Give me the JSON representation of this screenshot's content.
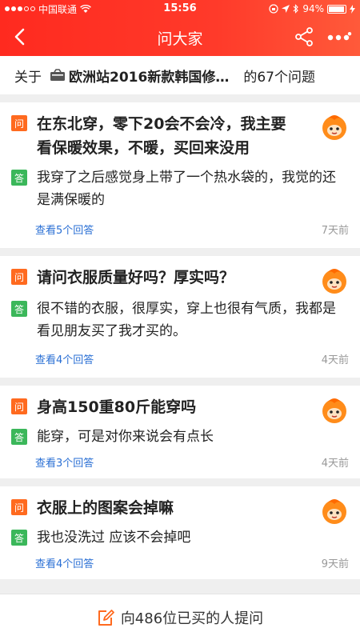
{
  "status_bar": {
    "carrier": "中国联通",
    "time": "15:56",
    "battery": "94%",
    "battery_level": 0.94
  },
  "nav": {
    "title": "问大家"
  },
  "about": {
    "prefix": "关于",
    "product": "欧洲站2016新款韩国修…",
    "suffix": "的67个问题"
  },
  "questions": [
    {
      "q_tag": "问",
      "question": "在东北穿，零下20会不会冷，我主要看保暖效果，不暖，买回来没用",
      "a_tag": "答",
      "answer": "我穿了之后感觉身上带了一个热水袋的，我觉的还是满保暖的",
      "link": "查看5个回答",
      "time": "7天前"
    },
    {
      "q_tag": "问",
      "question": "请问衣服质量好吗？厚实吗？",
      "a_tag": "答",
      "answer": "很不错的衣服，很厚实，穿上也很有气质，我都是看见朋友买了我才买的。",
      "link": "查看4个回答",
      "time": "4天前"
    },
    {
      "q_tag": "问",
      "question": "身高150重80斤能穿吗",
      "a_tag": "答",
      "answer": "能穿，可是对你来说会有点长",
      "link": "查看3个回答",
      "time": "4天前"
    },
    {
      "q_tag": "问",
      "question": "衣服上的图案会掉嘛",
      "a_tag": "答",
      "answer": "我也没洗过 应该不会掉吧",
      "link": "查看4个回答",
      "time": "9天前"
    }
  ],
  "bottom": {
    "label": "向486位已买的人提问"
  },
  "colors": {
    "header": "#ff3a2a",
    "question_tag": "#ff6a1f",
    "answer_tag": "#3bb75a",
    "link": "#2a6fd4"
  }
}
